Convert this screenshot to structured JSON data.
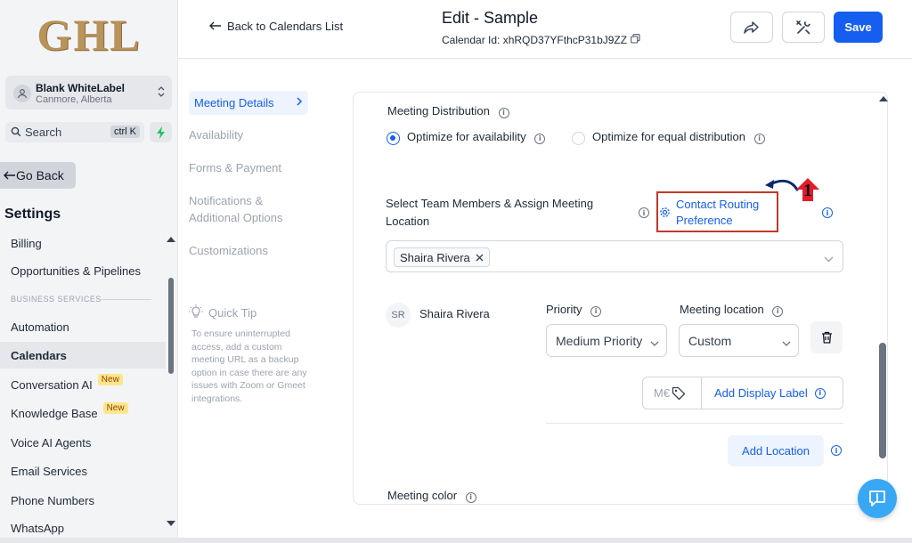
{
  "sidebar": {
    "logo": "GHL",
    "account_name": "Blank WhiteLabel",
    "account_location": "Canmore, Alberta",
    "search_label": "Search",
    "search_shortcut": "ctrl K",
    "go_back": "Go Back",
    "settings_title": "Settings",
    "section_business_services": "BUSINESS SERVICES",
    "items": [
      {
        "label": "Billing"
      },
      {
        "label": "Opportunities & Pipelines"
      },
      {
        "label": "Automation"
      },
      {
        "label": "Calendars"
      },
      {
        "label": "Conversation AI",
        "badge": "New"
      },
      {
        "label": "Knowledge Base",
        "badge": "New"
      },
      {
        "label": "Voice AI Agents"
      },
      {
        "label": "Email Services"
      },
      {
        "label": "Phone Numbers"
      },
      {
        "label": "WhatsApp"
      }
    ]
  },
  "header": {
    "back_link": "Back to Calendars List",
    "title": "Edit - Sample",
    "calendar_id": "Calendar Id: xhRQD37YFthcP31bJ9ZZ",
    "save_label": "Save"
  },
  "subnav": {
    "items": [
      "Meeting Details",
      "Availability",
      "Forms & Payment",
      "Notifications & Additional Options",
      "Customizations"
    ],
    "active": "Meeting Details",
    "tip_title": "Quick Tip",
    "tip_body": "To ensure uninterrupted access, add a custom meeting URL as a backup option in case there are any issues with Zoom or Gmeet integrations."
  },
  "form": {
    "distribution_label": "Meeting Distribution",
    "option_availability": "Optimize for availability",
    "option_equal": "Optimize for equal distribution",
    "team_label": "Select Team Members & Assign Meeting Location",
    "routing_link": "Contact Routing Preference",
    "selected_member": "Shaira Rivera",
    "member_initials": "SR",
    "member_name": "Shaira Rivera",
    "priority_label": "Priority",
    "priority_value": "Medium Priority",
    "location_label": "Meeting location",
    "location_value": "Custom",
    "label_placeholder": "M€",
    "add_display_label": "Add Display Label",
    "add_location": "Add Location",
    "meeting_color_label": "Meeting color"
  },
  "annotation": {
    "number": "1"
  },
  "colors": {
    "primary": "#155eef",
    "annotation_red": "#c0392b",
    "logo_gold": "#b8935a"
  }
}
